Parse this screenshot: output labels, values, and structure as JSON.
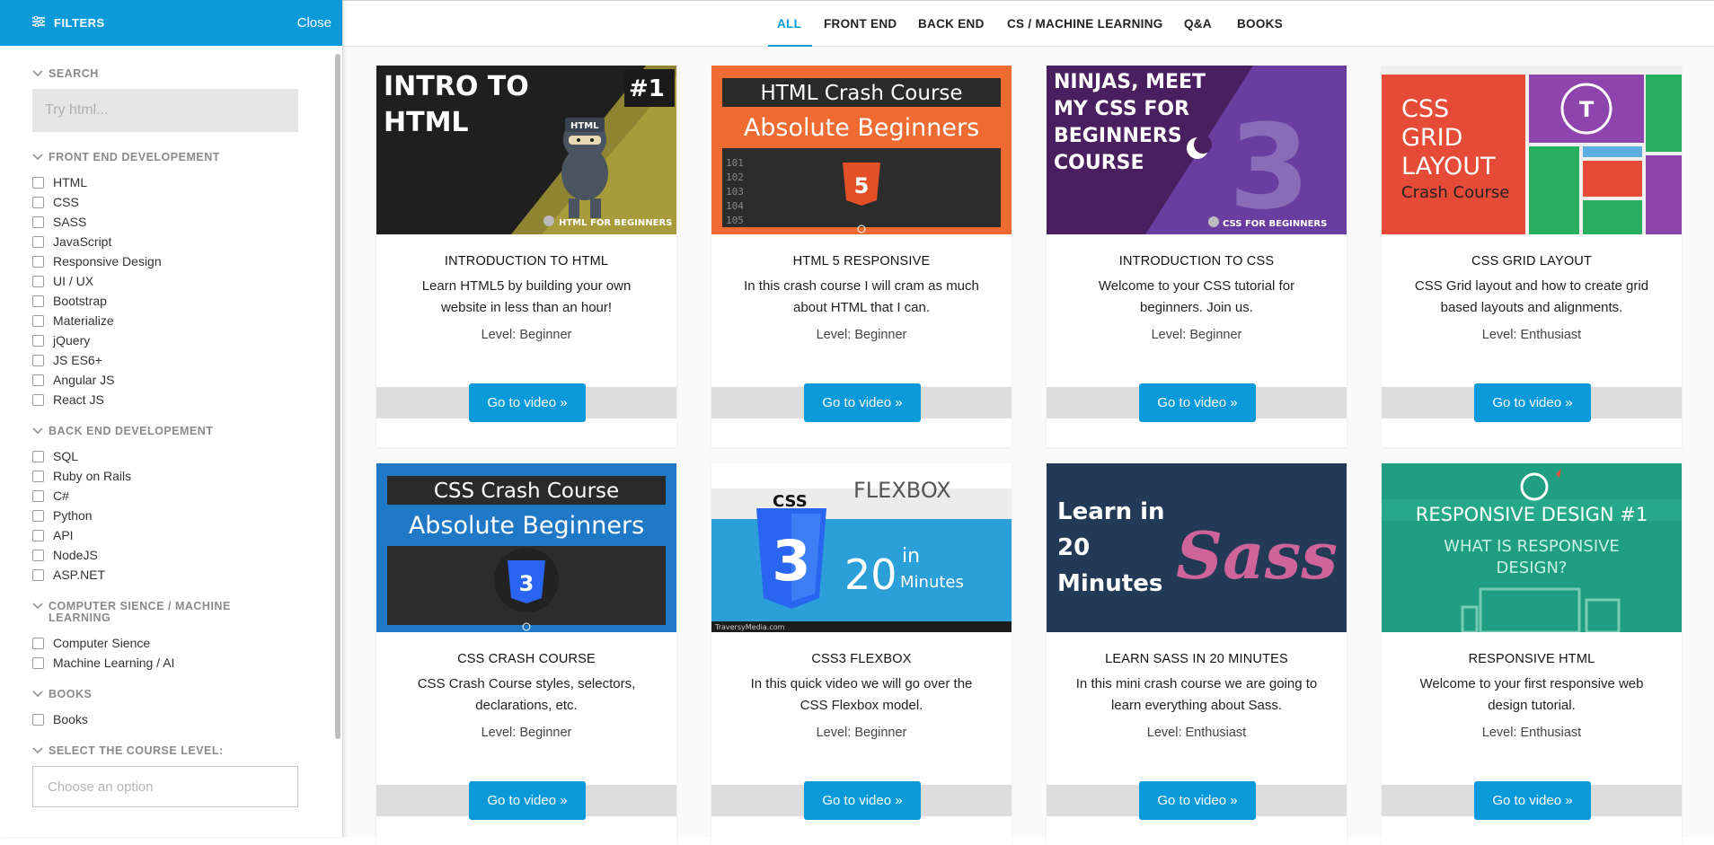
{
  "sidebar": {
    "title": "FILTERS",
    "close_label": "Close",
    "search": {
      "label": "SEARCH",
      "placeholder": "Try html..."
    },
    "sections": [
      {
        "title": "FRONT END DEVELOPEMENT",
        "items": [
          "HTML",
          "CSS",
          "SASS",
          "JavaScript",
          "Responsive Design",
          "UI / UX",
          "Bootstrap",
          "Materialize",
          "jQuery",
          "JS ES6+",
          "Angular JS",
          "React JS"
        ]
      },
      {
        "title": "BACK END DEVELOPEMENT",
        "items": [
          "SQL",
          "Ruby on Rails",
          "C#",
          "Python",
          "API",
          "NodeJS",
          "ASP.NET"
        ]
      },
      {
        "title": "COMPUTER SIENCE / MACHINE LEARNING",
        "items": [
          "Computer Sience",
          "Machine Learning / AI"
        ]
      },
      {
        "title": "BOOKS",
        "items": [
          "Books"
        ]
      }
    ],
    "level": {
      "label": "SELECT THE COURSE LEVEL:",
      "placeholder": "Choose an option"
    }
  },
  "nav": {
    "tabs": [
      "ALL",
      "FRONT END",
      "BACK END",
      "CS / MACHINE LEARNING",
      "Q&A",
      "BOOKS"
    ],
    "active": "ALL"
  },
  "cards": [
    {
      "title": "INTRODUCTION TO HTML",
      "desc": "Learn HTML5 by building your own website in less than an hour!",
      "level": "Level: Beginner",
      "button": "Go to video »",
      "thumb": {
        "line1": "INTRO TO",
        "line2": "HTML",
        "badge": "#1",
        "ninja": "HTML",
        "footer": "HTML FOR BEGINNERS"
      }
    },
    {
      "title": "HTML 5 RESPONSIVE",
      "desc": "In this crash course I will cram as much about HTML that I can.",
      "level": "Level: Beginner",
      "button": "Go to video »",
      "thumb": {
        "line1": "HTML Crash Course",
        "line2": "Absolute Beginners",
        "nums": [
          "101",
          "102",
          "103",
          "104",
          "105"
        ]
      }
    },
    {
      "title": "INTRODUCTION TO CSS",
      "desc": "Welcome to your CSS tutorial for beginners. Join us.",
      "level": "Level: Beginner",
      "button": "Go to video »",
      "thumb": {
        "lines": [
          "NINJAS, MEET",
          "MY CSS FOR",
          "BEGINNERS",
          "COURSE"
        ],
        "footer": "CSS FOR BEGINNERS"
      }
    },
    {
      "title": "CSS GRID LAYOUT",
      "desc": "CSS Grid layout and how to create grid based layouts and alignments.",
      "level": "Level: Enthusiast",
      "button": "Go to video »",
      "thumb": {
        "lines": [
          "CSS",
          "GRID",
          "LAYOUT"
        ],
        "sub": "Crash Course"
      }
    },
    {
      "title": "CSS CRASH COURSE",
      "desc": "CSS Crash Course styles, selectors, declarations, etc.",
      "level": "Level: Beginner",
      "button": "Go to video »",
      "thumb": {
        "line1": "CSS Crash Course",
        "line2": "Absolute Beginners"
      }
    },
    {
      "title": "CSS3 FLEXBOX",
      "desc": "In this quick video we will go over the CSS Flexbox model.",
      "level": "Level: Beginner",
      "button": "Go to video »",
      "thumb": {
        "top": "CSS",
        "flex": "FLEXBOX",
        "num": "20",
        "in": "in",
        "min": "Minutes",
        "credit": "TraversyMedia.com"
      }
    },
    {
      "title": "LEARN SASS IN 20 MINUTES",
      "desc": "In this mini crash course we are going to learn everything about Sass.",
      "level": "Level: Enthusiast",
      "button": "Go to video »",
      "thumb": {
        "lines": [
          "Learn in",
          "20",
          "Minutes"
        ],
        "logo": "Sass"
      }
    },
    {
      "title": "RESPONSIVE HTML",
      "desc": "Welcome to your first responsive web design tutorial.",
      "level": "Level: Enthusiast",
      "button": "Go to video »",
      "thumb": {
        "line1": "RESPONSIVE DESIGN #1",
        "line2": "WHAT IS RESPONSIVE",
        "line3": "DESIGN?"
      }
    }
  ],
  "colors": {
    "accent": "#0a9ad9",
    "band": "#dddddd"
  }
}
